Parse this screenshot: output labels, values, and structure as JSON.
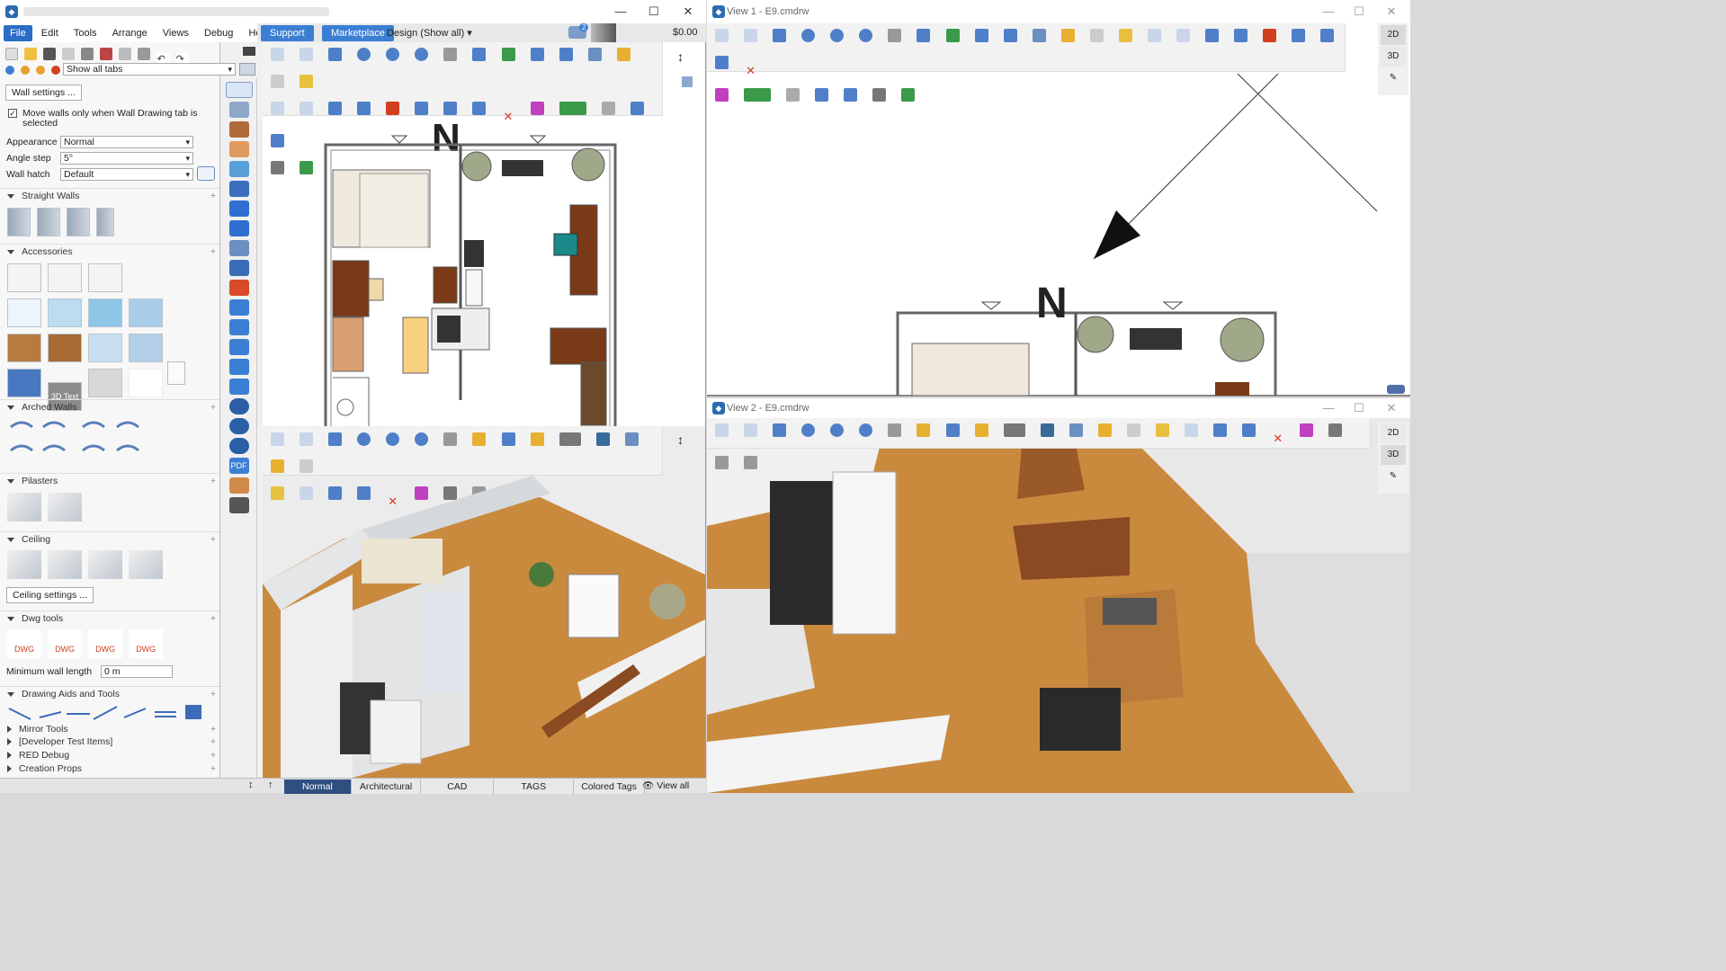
{
  "main_window": {
    "menu": [
      "File",
      "Edit",
      "Tools",
      "Arrange",
      "Views",
      "Debug",
      "Help"
    ],
    "support_label": "Support",
    "marketplace_label": "Marketplace",
    "design_dropdown": "Design (Show all)",
    "price": "$0.00",
    "notification_count": "2"
  },
  "left_panel": {
    "tabs_select": "Show all tabs",
    "wall_settings_btn": "Wall settings ...",
    "move_walls_checkbox": "Move walls only when Wall Drawing tab is selected",
    "appearance_label": "Appearance",
    "appearance_value": "Normal",
    "angle_label": "Angle step",
    "angle_value": "5°",
    "hatch_label": "Wall hatch",
    "hatch_value": "Default",
    "sections": {
      "straight_walls": "Straight Walls",
      "accessories": "Accessories",
      "arched_walls": "Arched Walls",
      "pilasters": "Pilasters",
      "ceiling": "Ceiling",
      "dwg_tools": "Dwg tools",
      "drawing_aids": "Drawing Aids and Tools",
      "mirror_tools": "Mirror Tools",
      "developer": "[Developer Test Items]",
      "red_debug": "RED Debug",
      "creation_props": "Creation Props"
    },
    "ceiling_settings_btn": "Ceiling settings ...",
    "min_wall_label": "Minimum wall length",
    "min_wall_value": "0 m",
    "text3d_label": "3D Text",
    "dwg_label": "DWG"
  },
  "vstrip": {
    "pdf_label": "PDF"
  },
  "compass_letter": "N",
  "bottom_tabs": [
    "Normal",
    "Architectural",
    "CAD",
    "TAGS",
    "Colored Tags"
  ],
  "view_all_label": "View all",
  "view1": {
    "title": "View 1 - E9.cmdrw",
    "btn_2d": "2D",
    "btn_3d": "3D"
  },
  "view2": {
    "title": "View 2 - E9.cmdrw",
    "btn_2d": "2D",
    "btn_3d": "3D"
  }
}
